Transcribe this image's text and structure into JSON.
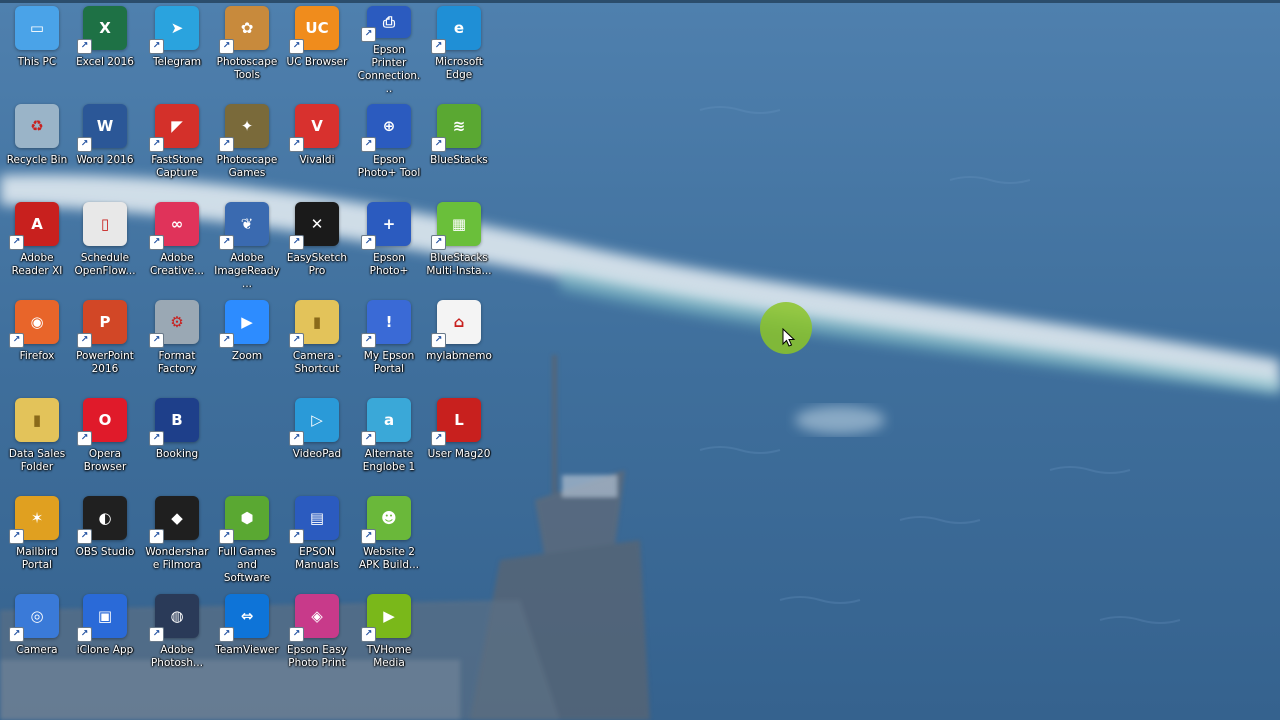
{
  "desktop": {
    "icons": [
      {
        "id": "this-pc",
        "label": "This PC",
        "glyph": "▭",
        "color": "#4aa3e8",
        "col": 0,
        "row": 0,
        "shortcut": false
      },
      {
        "id": "excel",
        "label": "Excel 2016",
        "glyph": "X",
        "color": "#1e7145",
        "col": 1,
        "row": 0,
        "shortcut": true
      },
      {
        "id": "telegram",
        "label": "Telegram",
        "glyph": "➤",
        "color": "#2aa3de",
        "col": 2,
        "row": 0,
        "shortcut": true
      },
      {
        "id": "photoscape-tools",
        "label": "Photoscape Tools",
        "glyph": "✿",
        "color": "#c88a3c",
        "col": 3,
        "row": 0,
        "shortcut": true
      },
      {
        "id": "uc-browser",
        "label": "UC Browser",
        "glyph": "UC",
        "color": "#f08c1c",
        "col": 4,
        "row": 0,
        "shortcut": true
      },
      {
        "id": "epson-printer-connection",
        "label": "Epson Printer Connection...",
        "glyph": "⎙",
        "color": "#2b5bbf",
        "col": 5,
        "row": 0,
        "shortcut": true
      },
      {
        "id": "microsoft-edge",
        "label": "Microsoft Edge",
        "glyph": "e",
        "color": "#1f8fd6",
        "col": 6,
        "row": 0,
        "shortcut": true
      },
      {
        "id": "recycle-bin",
        "label": "Recycle Bin",
        "glyph": "♻",
        "color": "#9ab4c8",
        "col": 0,
        "row": 1,
        "shortcut": false
      },
      {
        "id": "word",
        "label": "Word 2016",
        "glyph": "W",
        "color": "#2b5797",
        "col": 1,
        "row": 1,
        "shortcut": true
      },
      {
        "id": "faststone-capture",
        "label": "FastStone Capture",
        "glyph": "◤",
        "color": "#d4302a",
        "col": 2,
        "row": 1,
        "shortcut": true
      },
      {
        "id": "photoscape-games",
        "label": "Photoscape Games",
        "glyph": "✦",
        "color": "#7a6a3a",
        "col": 3,
        "row": 1,
        "shortcut": true
      },
      {
        "id": "vivaldi",
        "label": "Vivaldi",
        "glyph": "V",
        "color": "#d8312e",
        "col": 4,
        "row": 1,
        "shortcut": true
      },
      {
        "id": "epson-photo-tool",
        "label": "Epson Photo+ Tool",
        "glyph": "⊕",
        "color": "#2b5bbf",
        "col": 5,
        "row": 1,
        "shortcut": true
      },
      {
        "id": "bluestacks",
        "label": "BlueStacks",
        "glyph": "≋",
        "color": "#5aa832",
        "col": 6,
        "row": 1,
        "shortcut": true
      },
      {
        "id": "adobe-reader",
        "label": "Adobe Reader XI",
        "glyph": "A",
        "color": "#c8201e",
        "col": 0,
        "row": 2,
        "shortcut": true
      },
      {
        "id": "schedule",
        "label": "Schedule OpenFlow...",
        "glyph": "▯",
        "color": "#e8e8e8",
        "col": 1,
        "row": 2,
        "shortcut": false
      },
      {
        "id": "adobe-creative-cloud",
        "label": "Adobe Creative...",
        "glyph": "∞",
        "color": "#e0335a",
        "col": 2,
        "row": 2,
        "shortcut": true
      },
      {
        "id": "adobe-image-ready",
        "label": "Adobe ImageReady...",
        "glyph": "❦",
        "color": "#3a6ab0",
        "col": 3,
        "row": 2,
        "shortcut": true
      },
      {
        "id": "easysketchpro",
        "label": "EasySketchPro",
        "glyph": "✕",
        "color": "#1a1a1a",
        "col": 4,
        "row": 2,
        "shortcut": true
      },
      {
        "id": "epson-photo-plus",
        "label": "Epson Photo+",
        "glyph": "+",
        "color": "#2b5bbf",
        "col": 5,
        "row": 2,
        "shortcut": true
      },
      {
        "id": "bluestacks-multi",
        "label": "BlueStacks Multi-Insta...",
        "glyph": "▦",
        "color": "#6abf3a",
        "col": 6,
        "row": 2,
        "shortcut": true
      },
      {
        "id": "firefox",
        "label": "Firefox",
        "glyph": "◉",
        "color": "#e8652a",
        "col": 0,
        "row": 3,
        "shortcut": true
      },
      {
        "id": "powerpoint",
        "label": "PowerPoint 2016",
        "glyph": "P",
        "color": "#d24726",
        "col": 1,
        "row": 3,
        "shortcut": true
      },
      {
        "id": "format-factory",
        "label": "Format Factory",
        "glyph": "⚙",
        "color": "#9aa8b4",
        "col": 2,
        "row": 3,
        "shortcut": true
      },
      {
        "id": "zoom",
        "label": "Zoom",
        "glyph": "▶",
        "color": "#2d8cff",
        "col": 3,
        "row": 3,
        "shortcut": true
      },
      {
        "id": "camera-shortcut",
        "label": "Camera - Shortcut",
        "glyph": "▮",
        "color": "#e3c35a",
        "col": 4,
        "row": 3,
        "shortcut": true
      },
      {
        "id": "my-epson-portal",
        "label": "My Epson Portal",
        "glyph": "!",
        "color": "#3a6ad6",
        "col": 5,
        "row": 3,
        "shortcut": true
      },
      {
        "id": "mylabmemo",
        "label": "mylabmemo",
        "glyph": "⌂",
        "color": "#f4f4f4",
        "col": 6,
        "row": 3,
        "shortcut": true
      },
      {
        "id": "data-sales-folder",
        "label": "Data Sales Folder",
        "glyph": "▮",
        "color": "#e3c35a",
        "col": 0,
        "row": 4,
        "shortcut": false
      },
      {
        "id": "opera",
        "label": "Opera Browser",
        "glyph": "O",
        "color": "#e01a2a",
        "col": 1,
        "row": 4,
        "shortcut": true
      },
      {
        "id": "booking",
        "label": "Booking",
        "glyph": "B",
        "color": "#1e3f8a",
        "col": 2,
        "row": 4,
        "shortcut": true
      },
      {
        "id": "videopad",
        "label": "VideoPad",
        "glyph": "▷",
        "color": "#2a9ad8",
        "col": 4,
        "row": 4,
        "shortcut": true
      },
      {
        "id": "alternate-englobe",
        "label": "Alternate Englobe 1",
        "glyph": "a",
        "color": "#3aa8d8",
        "col": 5,
        "row": 4,
        "shortcut": true
      },
      {
        "id": "user-mag",
        "label": "User Mag20",
        "glyph": "L",
        "color": "#c8201e",
        "col": 6,
        "row": 4,
        "shortcut": true
      },
      {
        "id": "mailbird-portal",
        "label": "Mailbird Portal",
        "glyph": "✶",
        "color": "#e0a020",
        "col": 0,
        "row": 5,
        "shortcut": true
      },
      {
        "id": "obs-studio",
        "label": "OBS Studio",
        "glyph": "◐",
        "color": "#202020",
        "col": 1,
        "row": 5,
        "shortcut": true
      },
      {
        "id": "wondershare-filmora",
        "label": "Wondershare Filmora",
        "glyph": "◆",
        "color": "#1f1f1f",
        "col": 2,
        "row": 5,
        "shortcut": true
      },
      {
        "id": "full-games",
        "label": "Full Games and Software",
        "glyph": "⬢",
        "color": "#5aa832",
        "col": 3,
        "row": 5,
        "shortcut": true
      },
      {
        "id": "epson-manuals",
        "label": "EPSON Manuals",
        "glyph": "▤",
        "color": "#2b5bbf",
        "col": 4,
        "row": 5,
        "shortcut": true
      },
      {
        "id": "website-apk",
        "label": "Website 2 APK Build...",
        "glyph": "☻",
        "color": "#6ab83a",
        "col": 5,
        "row": 5,
        "shortcut": true
      },
      {
        "id": "camera",
        "label": "Camera",
        "glyph": "◎",
        "color": "#3a7ad8",
        "col": 0,
        "row": 6,
        "shortcut": true
      },
      {
        "id": "iclone",
        "label": "iClone App",
        "glyph": "▣",
        "color": "#2a6ad8",
        "col": 1,
        "row": 6,
        "shortcut": true
      },
      {
        "id": "adobe-photoshop",
        "label": "Adobe Photosh...",
        "glyph": "◍",
        "color": "#2a3a58",
        "col": 2,
        "row": 6,
        "shortcut": true
      },
      {
        "id": "teamviewer",
        "label": "TeamViewer",
        "glyph": "⇔",
        "color": "#0e74d8",
        "col": 3,
        "row": 6,
        "shortcut": true
      },
      {
        "id": "epson-easy-photo-print",
        "label": "Epson Easy Photo Print",
        "glyph": "◈",
        "color": "#c83a8a",
        "col": 4,
        "row": 6,
        "shortcut": true
      },
      {
        "id": "tvhome-media",
        "label": "TVHome Media",
        "glyph": "▶",
        "color": "#7ab81a",
        "col": 5,
        "row": 6,
        "shortcut": true
      }
    ]
  },
  "colors": {
    "sea_light": "#5a8ab8",
    "sea_dark": "#2e5c86",
    "foam": "#e8f0f4",
    "cursor_highlight": "#8cc428"
  }
}
